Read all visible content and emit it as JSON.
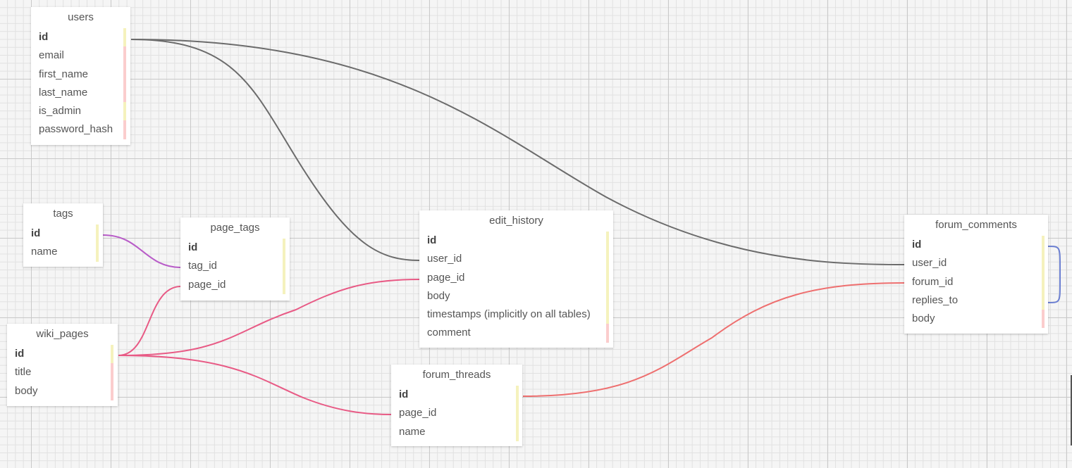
{
  "colors": {
    "link_users": "#6b6b6b",
    "link_tags": "#b85cc8",
    "link_wiki_pages": "#e85a85",
    "link_forum_threads": "#ee6f6f",
    "link_self": "#6b7fd1",
    "bar_nullable": "#f5f2bd",
    "bar_required": "#fbcdcd"
  },
  "tables": {
    "users": {
      "title": "users",
      "fields": [
        "id",
        "email",
        "first_name",
        "last_name",
        "is_admin",
        "password_hash"
      ],
      "flags": [
        "n",
        "r",
        "r",
        "r",
        "n",
        "r"
      ]
    },
    "tags": {
      "title": "tags",
      "fields": [
        "id",
        "name"
      ],
      "flags": [
        "n",
        "n"
      ]
    },
    "page_tags": {
      "title": "page_tags",
      "fields": [
        "id",
        "tag_id",
        "page_id"
      ],
      "flags": [
        "n",
        "n",
        "n"
      ]
    },
    "wiki_pages": {
      "title": "wiki_pages",
      "fields": [
        "id",
        "title",
        "body"
      ],
      "flags": [
        "n",
        "r",
        "r"
      ]
    },
    "edit_history": {
      "title": "edit_history",
      "fields": [
        "id",
        "user_id",
        "page_id",
        "body",
        "timestamps (implicitly on all tables)",
        "comment"
      ],
      "flags": [
        "n",
        "n",
        "n",
        "n",
        "n",
        "r"
      ]
    },
    "forum_threads": {
      "title": "forum_threads",
      "fields": [
        "id",
        "page_id",
        "name"
      ],
      "flags": [
        "n",
        "n",
        "n"
      ]
    },
    "forum_comments": {
      "title": "forum_comments",
      "fields": [
        "id",
        "user_id",
        "forum_id",
        "replies_to",
        "body"
      ],
      "flags": [
        "n",
        "n",
        "n",
        "n",
        "r"
      ]
    }
  }
}
